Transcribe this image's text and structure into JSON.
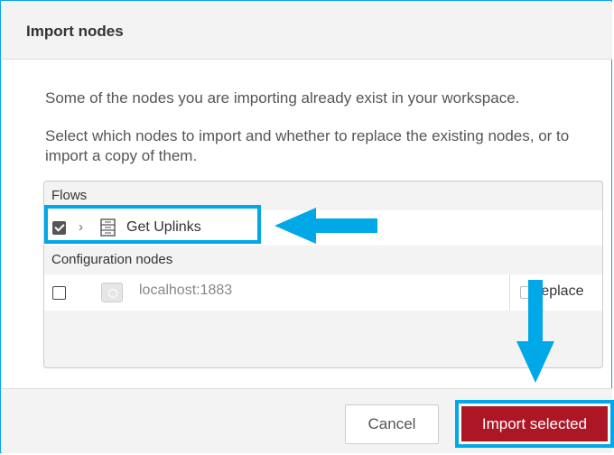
{
  "dialog": {
    "title": "Import nodes",
    "message_exists": "Some of the nodes you are importing already exist in your workspace.",
    "message_select": "Select which nodes to import and whether to replace the existing nodes, or to import a copy of them."
  },
  "flows_section": {
    "header": "Flows",
    "items": [
      {
        "label": "Get Uplinks",
        "checked": true,
        "expand_icon": "chevron-right-icon",
        "type_icon": "flow-icon"
      }
    ]
  },
  "config_section": {
    "header": "Configuration nodes",
    "items": [
      {
        "label": "localhost:1883",
        "checked": false,
        "replace_label": "replace",
        "replace_checked": false
      }
    ]
  },
  "footer": {
    "cancel_label": "Cancel",
    "import_label": "Import selected"
  },
  "colors": {
    "highlight": "#00a8e8",
    "primary_button": "#ad1625"
  }
}
